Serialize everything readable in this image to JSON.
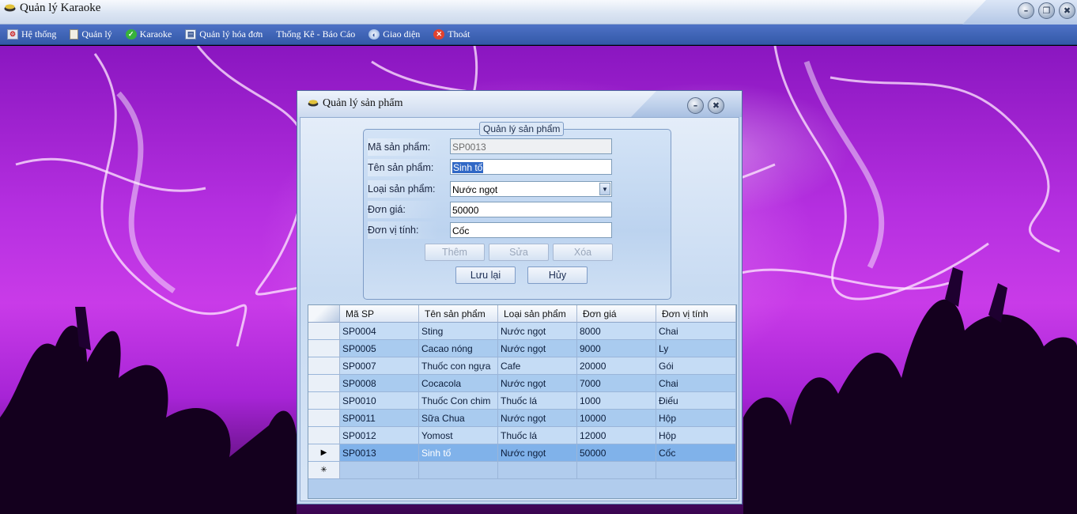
{
  "app": {
    "title": "Quản lý Karaoke"
  },
  "menu": [
    {
      "label": "Hệ thống",
      "icon": "system-icon"
    },
    {
      "label": "Quản lý",
      "icon": "document-icon"
    },
    {
      "label": "Karaoke",
      "icon": "check-icon"
    },
    {
      "label": "Quản lý hóa đơn",
      "icon": "invoice-icon"
    },
    {
      "label": "Thống Kê - Báo Cáo",
      "icon": ""
    },
    {
      "label": "Giao diện",
      "icon": "theme-icon"
    },
    {
      "label": "Thoát",
      "icon": "exit-icon"
    }
  ],
  "window_controls": {
    "minimize": "–",
    "restore": "❐",
    "close": "✖"
  },
  "dialog": {
    "title": "Quản lý sản phẩm",
    "group_title": "Quản lý sản phẩm",
    "fields": {
      "code": {
        "label": "Mã sản phẩm:",
        "value": "SP0013"
      },
      "name": {
        "label": "Tên sản phẩm:",
        "value": "Sinh tố"
      },
      "type": {
        "label": "Loại sản phẩm:",
        "value": "Nước ngọt"
      },
      "price": {
        "label": "Đơn giá:",
        "value": "50000"
      },
      "unit": {
        "label": "Đơn vị tính:",
        "value": "Cốc"
      }
    },
    "buttons": {
      "add": "Thêm",
      "edit": "Sửa",
      "delete": "Xóa",
      "save": "Lưu lại",
      "cancel": "Hủy"
    }
  },
  "grid": {
    "columns": [
      "Mã SP",
      "Tên sản phẩm",
      "Loại sản phẩm",
      "Đơn giá",
      "Đơn vị tính"
    ],
    "rows": [
      [
        "SP0004",
        "Sting",
        "Nước ngọt",
        "8000",
        "Chai"
      ],
      [
        "SP0005",
        "Cacao nóng",
        "Nước ngọt",
        "9000",
        "Ly"
      ],
      [
        "SP0007",
        "Thuốc con ngựa",
        "Cafe",
        "20000",
        "Gói"
      ],
      [
        "SP0008",
        "Cocacola",
        "Nước ngọt",
        "7000",
        "Chai"
      ],
      [
        "SP0010",
        "Thuốc Con chim",
        "Thuốc lá",
        "1000",
        "Điếu"
      ],
      [
        "SP0011",
        "Sữa Chua",
        "Nước ngọt",
        "10000",
        "Hộp"
      ],
      [
        "SP0012",
        "Yomost",
        "Thuốc lá",
        "12000",
        "Hộp"
      ],
      [
        "SP0013",
        "Sinh tố",
        "Nước ngọt",
        "50000",
        "Cốc"
      ]
    ],
    "current_row_marker": "▶",
    "new_row_marker": "✳"
  }
}
